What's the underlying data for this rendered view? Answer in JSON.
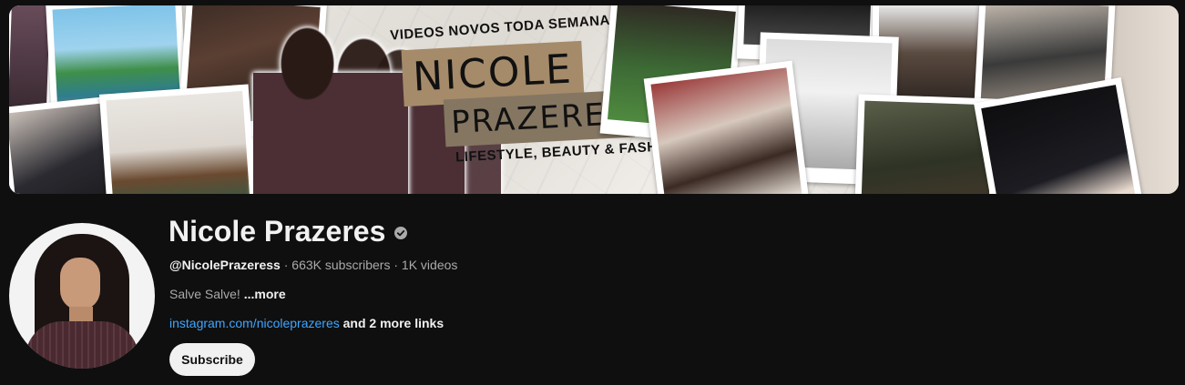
{
  "banner": {
    "headline": "VIDEOS NOVOS TODA SEMANA!",
    "name_line1": "NICOLE",
    "name_line2": "PRAZERES",
    "tagline": "LIFESTYLE, BEAUTY & FASHION"
  },
  "channel": {
    "name": "Nicole Prazeres",
    "verified_icon": "verified-check-icon",
    "handle": "@NicolePrazeress",
    "separator": "·",
    "subscribers": "663K subscribers",
    "videos": "1K videos",
    "description": "Salve Salve!",
    "more_label": "...more",
    "link": "instagram.com/nicoleprazeres",
    "more_links": "and 2 more links",
    "subscribe_label": "Subscribe"
  },
  "colors": {
    "background": "#0f0f0f",
    "text_primary": "#f1f1f1",
    "text_secondary": "#aaaaaa",
    "link": "#3ea6ff",
    "banner_accent": "#a58b6a"
  }
}
